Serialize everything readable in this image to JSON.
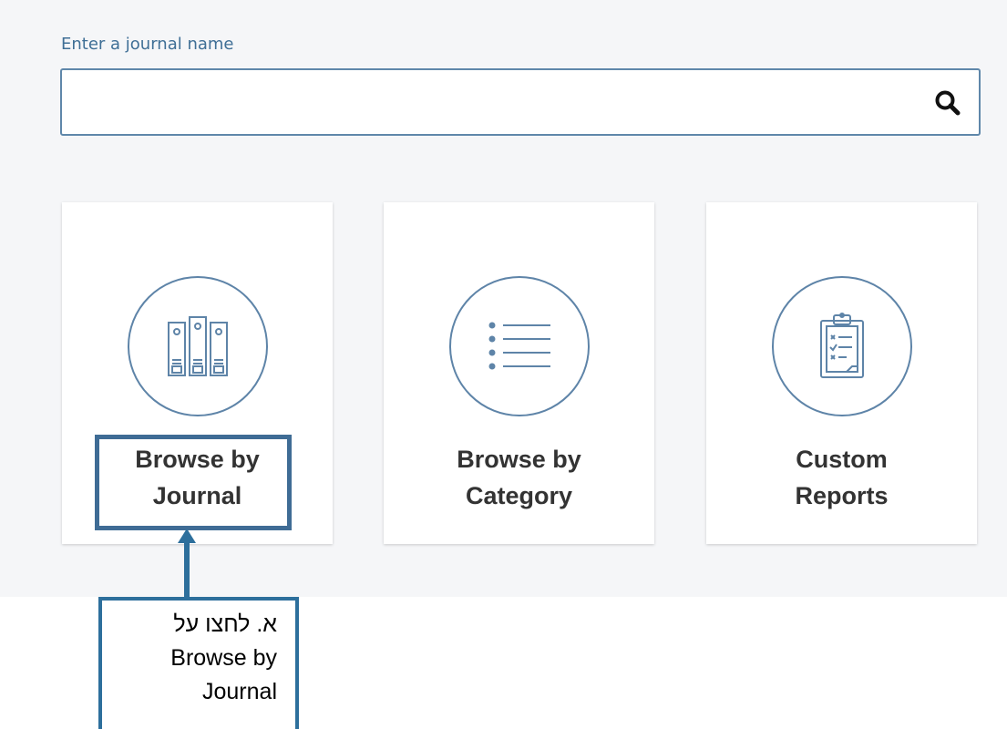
{
  "search": {
    "label": "Enter a journal name",
    "value": "",
    "placeholder": ""
  },
  "cards": [
    {
      "label": "Browse by\nJournal"
    },
    {
      "label": "Browse by\nCategory"
    },
    {
      "label": "Custom\nReports"
    }
  ],
  "annotation": {
    "lines": [
      "א. לחצו על",
      "Browse by",
      "Journal"
    ]
  },
  "colors": {
    "accent": "#3f6f96",
    "annotation": "#2d6f9c",
    "panel_background": "#f5f6f8"
  },
  "icons": {
    "search": "search-icon",
    "journals": "binders-icon",
    "category": "list-icon",
    "reports": "clipboard-icon"
  }
}
